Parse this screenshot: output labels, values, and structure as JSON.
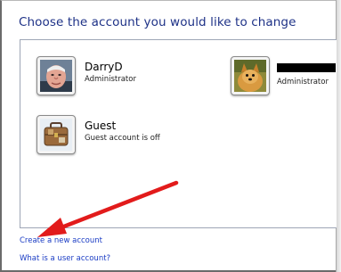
{
  "title": "Choose the account you would like to change",
  "accounts": [
    {
      "name": "DarryD",
      "role": "Administrator",
      "avatar": "man-face-picture"
    },
    {
      "name": "",
      "role": "Administrator",
      "avatar": "dog-picture",
      "name_redacted": true
    },
    {
      "name": "Guest",
      "role": "Guest account is off",
      "avatar": "suitcase-picture"
    }
  ],
  "links": {
    "create": "Create a new account",
    "what": "What is a user account?"
  },
  "colors": {
    "title": "#1e3287",
    "link": "#1a3cc4",
    "annotation_arrow": "#e21b1b"
  }
}
